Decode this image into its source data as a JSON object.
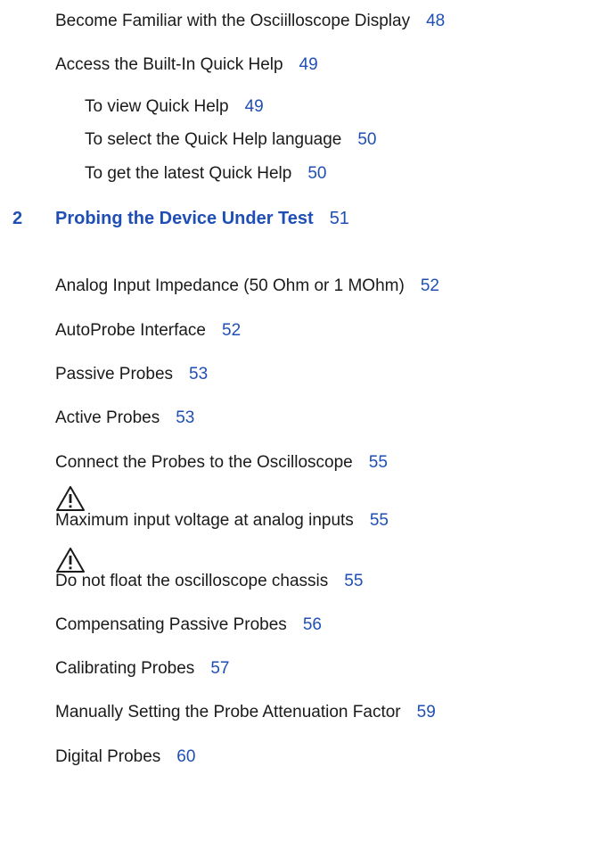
{
  "toc": {
    "entries_top": [
      {
        "title": "Become Familiar with the Osciilloscope Display",
        "page": "48"
      },
      {
        "title": "Access the Built-In Quick Help",
        "page": "49"
      }
    ],
    "quick_help_sub": [
      {
        "title": "To view Quick Help",
        "page": "49"
      },
      {
        "title": "To select the Quick Help language",
        "page": "50"
      },
      {
        "title": "To get the latest Quick Help",
        "page": "50"
      }
    ],
    "chapter": {
      "number": "2",
      "title": "Probing the Device Under Test",
      "page": "51"
    },
    "entries_chapter": [
      {
        "title": "Analog Input Impedance (50 Ohm or 1 MOhm)",
        "page": "52"
      },
      {
        "title": "AutoProbe Interface",
        "page": "52"
      },
      {
        "title": "Passive Probes",
        "page": "53"
      },
      {
        "title": "Active Probes",
        "page": "53"
      },
      {
        "title": "Connect the Probes to the Oscilloscope",
        "page": "55"
      },
      {
        "title": "Maximum input voltage at analog inputs",
        "page": "55"
      },
      {
        "title": "Do not float the oscilloscope chassis",
        "page": "55"
      },
      {
        "title": "Compensating Passive Probes",
        "page": "56"
      },
      {
        "title": "Calibrating Probes",
        "page": "57"
      },
      {
        "title": "Manually Setting the Probe Attenuation Factor",
        "page": "59"
      },
      {
        "title": "Digital Probes",
        "page": "60"
      }
    ]
  },
  "colors": {
    "link": "#1f4fb4",
    "text": "#1a1a1a"
  },
  "icons": {
    "warning": "warning-triangle-icon"
  }
}
